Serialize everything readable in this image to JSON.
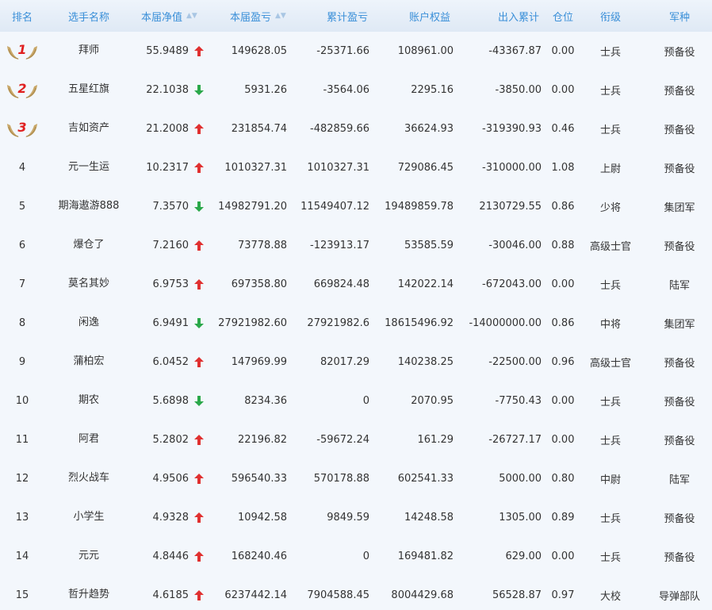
{
  "header": {
    "rank": "排名",
    "name": "选手名称",
    "net_value": "本届净值",
    "pnl": "本届盈亏",
    "cum_pnl": "累计盈亏",
    "equity": "账户权益",
    "flow": "出入累计",
    "position": "仓位",
    "title": "衔级",
    "branch": "军种"
  },
  "colors": {
    "header_text": "#3a8fd8",
    "up_arrow": "#e03030",
    "down_arrow": "#2aa84a",
    "medal_number": "#e02020",
    "row_background": "#f3f7fc"
  },
  "rows": [
    {
      "rank": "1",
      "medal": true,
      "name": "拜师",
      "nav": "55.9489",
      "trend": "up",
      "pnl": "149628.05",
      "cum": "-25371.66",
      "equity": "108961.00",
      "flow": "-43367.87",
      "pos": "0.00",
      "title": "士兵",
      "branch": "预备役"
    },
    {
      "rank": "2",
      "medal": true,
      "name": "五星红旗",
      "nav": "22.1038",
      "trend": "down",
      "pnl": "5931.26",
      "cum": "-3564.06",
      "equity": "2295.16",
      "flow": "-3850.00",
      "pos": "0.00",
      "title": "士兵",
      "branch": "预备役"
    },
    {
      "rank": "3",
      "medal": true,
      "name": "吉如资产",
      "nav": "21.2008",
      "trend": "up",
      "pnl": "231854.74",
      "cum": "-482859.66",
      "equity": "36624.93",
      "flow": "-319390.93",
      "pos": "0.46",
      "title": "士兵",
      "branch": "预备役"
    },
    {
      "rank": "4",
      "medal": false,
      "name": "元一生运",
      "nav": "10.2317",
      "trend": "up",
      "pnl": "1010327.31",
      "cum": "1010327.31",
      "equity": "729086.45",
      "flow": "-310000.00",
      "pos": "1.08",
      "title": "上尉",
      "branch": "预备役"
    },
    {
      "rank": "5",
      "medal": false,
      "name": "期海遨游888",
      "nav": "7.3570",
      "trend": "down",
      "pnl": "14982791.20",
      "cum": "11549407.12",
      "equity": "19489859.78",
      "flow": "2130729.55",
      "pos": "0.86",
      "title": "少将",
      "branch": "集团军"
    },
    {
      "rank": "6",
      "medal": false,
      "name": "爆仓了",
      "nav": "7.2160",
      "trend": "up",
      "pnl": "73778.88",
      "cum": "-123913.17",
      "equity": "53585.59",
      "flow": "-30046.00",
      "pos": "0.88",
      "title": "高级士官",
      "branch": "预备役"
    },
    {
      "rank": "7",
      "medal": false,
      "name": "莫名其妙",
      "nav": "6.9753",
      "trend": "up",
      "pnl": "697358.80",
      "cum": "669824.48",
      "equity": "142022.14",
      "flow": "-672043.00",
      "pos": "0.00",
      "title": "士兵",
      "branch": "陆军"
    },
    {
      "rank": "8",
      "medal": false,
      "name": "闲逸",
      "nav": "6.9491",
      "trend": "down",
      "pnl": "27921982.60",
      "cum": "27921982.6",
      "equity": "18615496.92",
      "flow": "-14000000.00",
      "pos": "0.86",
      "title": "中将",
      "branch": "集团军"
    },
    {
      "rank": "9",
      "medal": false,
      "name": "蒲柏宏",
      "nav": "6.0452",
      "trend": "up",
      "pnl": "147969.99",
      "cum": "82017.29",
      "equity": "140238.25",
      "flow": "-22500.00",
      "pos": "0.96",
      "title": "高级士官",
      "branch": "预备役"
    },
    {
      "rank": "10",
      "medal": false,
      "name": "期农",
      "nav": "5.6898",
      "trend": "down",
      "pnl": "8234.36",
      "cum": "0",
      "equity": "2070.95",
      "flow": "-7750.43",
      "pos": "0.00",
      "title": "士兵",
      "branch": "预备役"
    },
    {
      "rank": "11",
      "medal": false,
      "name": "阿君",
      "nav": "5.2802",
      "trend": "up",
      "pnl": "22196.82",
      "cum": "-59672.24",
      "equity": "161.29",
      "flow": "-26727.17",
      "pos": "0.00",
      "title": "士兵",
      "branch": "预备役"
    },
    {
      "rank": "12",
      "medal": false,
      "name": "烈火战车",
      "nav": "4.9506",
      "trend": "up",
      "pnl": "596540.33",
      "cum": "570178.88",
      "equity": "602541.33",
      "flow": "5000.00",
      "pos": "0.80",
      "title": "中尉",
      "branch": "陆军"
    },
    {
      "rank": "13",
      "medal": false,
      "name": "小学生",
      "nav": "4.9328",
      "trend": "up",
      "pnl": "10942.58",
      "cum": "9849.59",
      "equity": "14248.58",
      "flow": "1305.00",
      "pos": "0.89",
      "title": "士兵",
      "branch": "预备役"
    },
    {
      "rank": "14",
      "medal": false,
      "name": "元元",
      "nav": "4.8446",
      "trend": "up",
      "pnl": "168240.46",
      "cum": "0",
      "equity": "169481.82",
      "flow": "629.00",
      "pos": "0.00",
      "title": "士兵",
      "branch": "预备役"
    },
    {
      "rank": "15",
      "medal": false,
      "name": "哲升趋势",
      "nav": "4.6185",
      "trend": "up",
      "pnl": "6237442.14",
      "cum": "7904588.45",
      "equity": "8004429.68",
      "flow": "56528.87",
      "pos": "0.97",
      "title": "大校",
      "branch": "导弹部队"
    }
  ]
}
